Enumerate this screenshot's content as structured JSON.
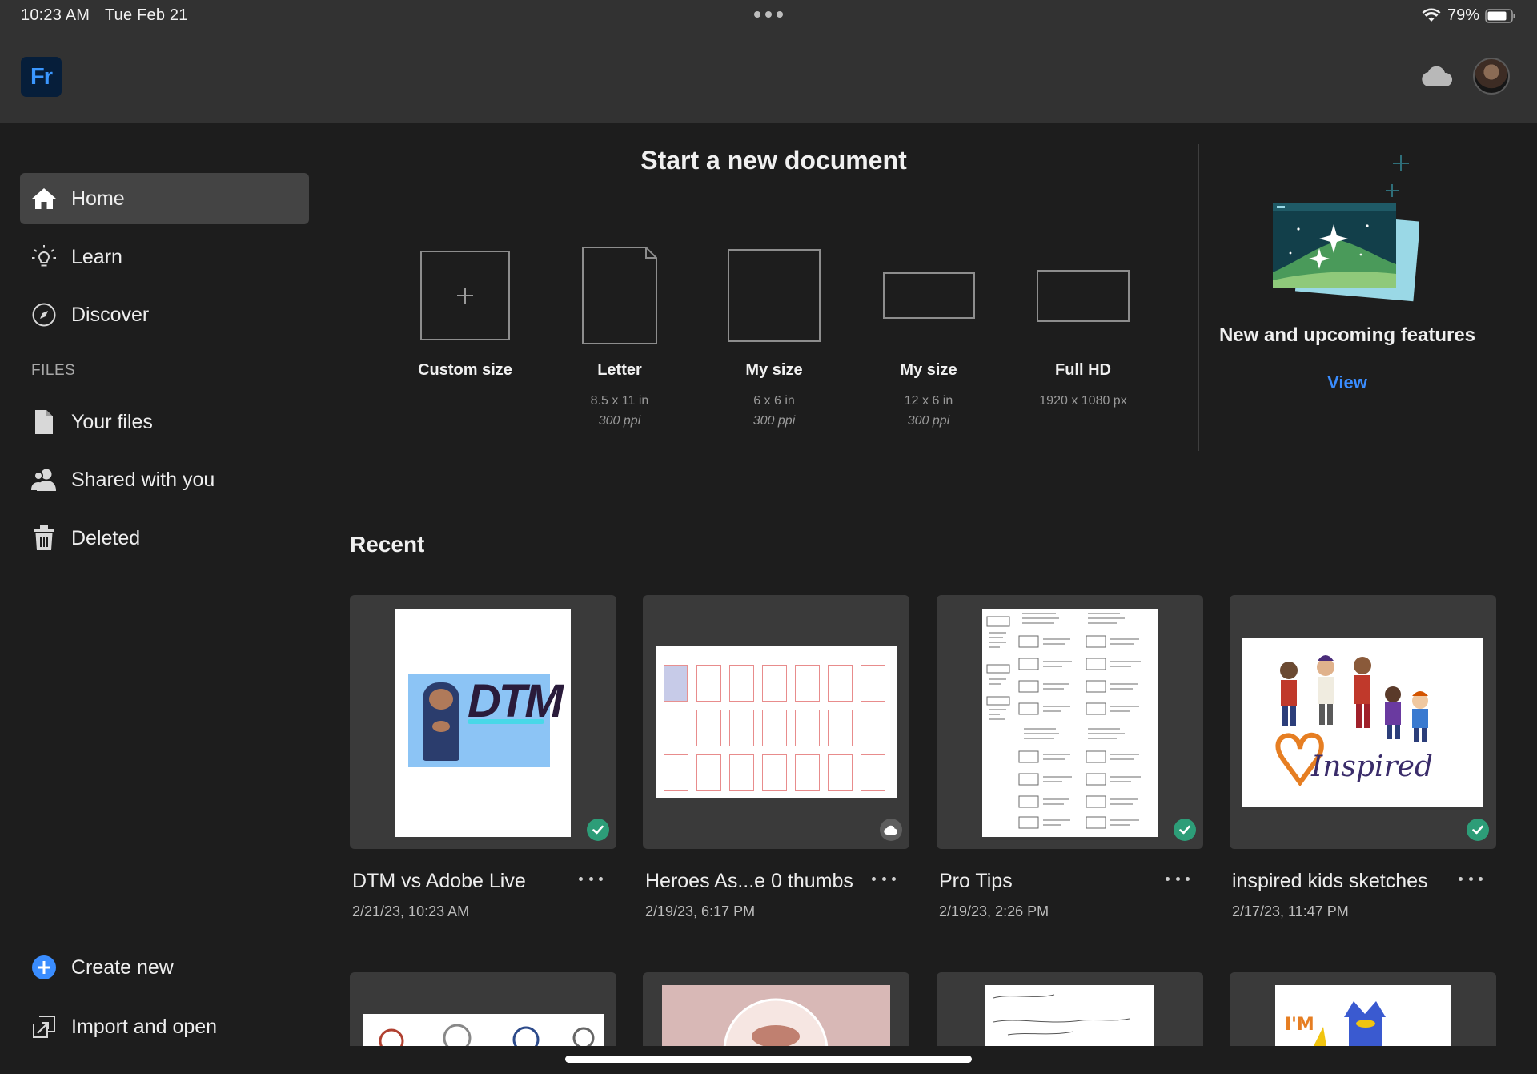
{
  "status_bar": {
    "time": "10:23 AM",
    "date": "Tue Feb 21",
    "battery": "79%"
  },
  "app": {
    "logo_text": "Fr",
    "accent": "#3a8dff"
  },
  "sidebar": {
    "items": [
      {
        "label": "Home",
        "icon": "home-icon"
      },
      {
        "label": "Learn",
        "icon": "lightbulb-icon"
      },
      {
        "label": "Discover",
        "icon": "compass-icon"
      }
    ],
    "files_header": "FILES",
    "files": [
      {
        "label": "Your files",
        "icon": "file-icon"
      },
      {
        "label": "Shared with you",
        "icon": "users-icon"
      },
      {
        "label": "Deleted",
        "icon": "trash-icon"
      }
    ],
    "actions": [
      {
        "label": "Create new",
        "icon": "plus-circle-icon"
      },
      {
        "label": "Import and open",
        "icon": "import-icon"
      }
    ]
  },
  "new_document": {
    "title": "Start a new document",
    "presets": [
      {
        "name": "Custom size",
        "dim": "",
        "ppi": ""
      },
      {
        "name": "Letter",
        "dim": "8.5 x 11 in",
        "ppi": "300 ppi"
      },
      {
        "name": "My size",
        "dim": "6 x 6 in",
        "ppi": "300 ppi"
      },
      {
        "name": "My size",
        "dim": "12 x 6 in",
        "ppi": "300 ppi"
      },
      {
        "name": "Full HD",
        "dim": "1920 x 1080 px",
        "ppi": ""
      }
    ]
  },
  "features": {
    "title": "New and upcoming features",
    "view_label": "View"
  },
  "recent": {
    "title": "Recent",
    "files": [
      {
        "name": "DTM vs Adobe Live",
        "date": "2/21/23, 10:23 AM",
        "sync": "synced"
      },
      {
        "name": "Heroes As...e 0 thumbs",
        "date": "2/19/23, 6:17 PM",
        "sync": "cloud"
      },
      {
        "name": "Pro Tips",
        "date": "2/19/23, 2:26 PM",
        "sync": "synced"
      },
      {
        "name": "inspired kids sketches",
        "date": "2/17/23, 11:47 PM",
        "sync": "synced"
      }
    ],
    "thumb_text": {
      "dtm_logo": "DTM",
      "inspired_script": "Inspired",
      "im_text": "I'M"
    }
  }
}
